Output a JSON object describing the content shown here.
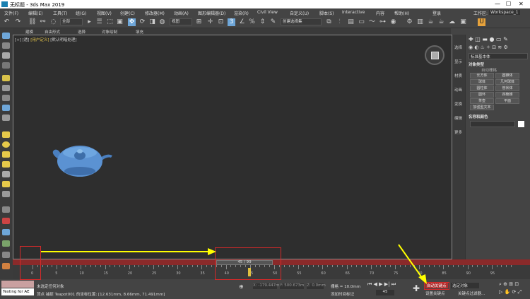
{
  "window": {
    "title": "无标题 - 3ds Max 2019",
    "minimize": "—",
    "maximize": "☐",
    "close": "✕"
  },
  "menu": [
    "文件(F)",
    "编辑(E)",
    "工具(T)",
    "组(G)",
    "视图(V)",
    "创建(C)",
    "修改器(M)",
    "动画(A)",
    "图形编辑器(D)",
    "渲染(R)",
    "Civil View",
    "自定义(U)",
    "脚本(S)",
    "Interactive",
    "内容",
    "帮助(H)"
  ],
  "account": {
    "login": "登录",
    "workspace_label": "工作区:",
    "workspace": "Workspace_1"
  },
  "toolbar": {
    "all_dropdown": "全部",
    "view_dropdown": "视图",
    "selection_set": "创建选择集"
  },
  "ribbon": [
    "建模",
    "自由形式",
    "选择",
    "对象绘制",
    "填充"
  ],
  "viewport": {
    "label_prefix": "[+] [透] ",
    "label_highlight": "[用户定义]",
    "label_suffix": " [默认明暗处理]"
  },
  "right_column": [
    "选择",
    "显示",
    "材质",
    "动画",
    "变换",
    "编辑",
    "更多"
  ],
  "command_panel": {
    "category": "标准基本体",
    "object_type_header": "对象类型",
    "autogrid": "自动栅格",
    "buttons": [
      "长方体",
      "圆锥体",
      "球体",
      "几何球体",
      "圆柱体",
      "管状体",
      "圆环",
      "四棱锥",
      "茶壶",
      "平面",
      "加强型文本"
    ],
    "name_color_header": "名称和颜色"
  },
  "timeline": {
    "slider_text": "45 / 99",
    "ticks": [
      "0",
      "5",
      "10",
      "15",
      "20",
      "25",
      "30",
      "35",
      "40",
      "45",
      "50",
      "55",
      "60",
      "65",
      "70",
      "75",
      "80",
      "85",
      "90",
      "95"
    ]
  },
  "status": {
    "maxscript": "Testing for AE",
    "selection": "未选定任何对象",
    "prompt": "顶点 捕捉 Teapot001 的坐标位置: [12.631mm, 8.66mm, 71.491mm]",
    "x": "X: -179.447m",
    "y": "Y: 500.673m",
    "z": "Z: 0.0mm",
    "grid": "栅格 = 10.0mm",
    "add_time_tag": "添加时间标记",
    "frame": "45",
    "autokey": "自动关键点",
    "selected_objects": "选定对象",
    "set_key": "设置关键点",
    "key_filters": "关键点过滤器..."
  }
}
